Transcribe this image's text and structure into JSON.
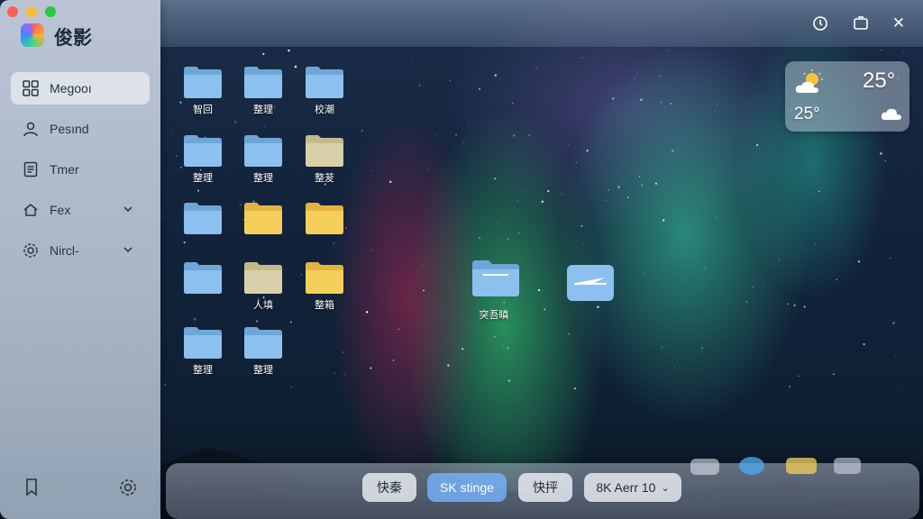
{
  "app": {
    "title": "俊影"
  },
  "sidebar": {
    "items": [
      {
        "label": "Megooı",
        "icon": "grid-icon",
        "active": true,
        "chevron": ""
      },
      {
        "label": "Pesınd",
        "icon": "person-icon",
        "active": false,
        "chevron": ""
      },
      {
        "label": "Tmer",
        "icon": "document-icon",
        "active": false,
        "chevron": ""
      },
      {
        "label": "Fex",
        "icon": "home-icon",
        "active": false,
        "chevron": "⌄"
      },
      {
        "label": "Nircl-",
        "icon": "gear-icon",
        "active": false,
        "chevron": "⌄"
      }
    ],
    "bottom": {
      "left_icon": "bookmark-icon",
      "right_icon": "settings-icon"
    }
  },
  "window_controls": {
    "icons": [
      "timer-icon",
      "restore-icon",
      "close-icon"
    ],
    "close_glyph": "✕"
  },
  "desktop": {
    "folders": [
      {
        "label": "智回",
        "color": "blue"
      },
      {
        "label": "整理",
        "color": "blue"
      },
      {
        "label": "校潮",
        "color": "blue"
      },
      {
        "label": "整理",
        "color": "blue"
      },
      {
        "label": "整理",
        "color": "blue"
      },
      {
        "label": "整茇",
        "color": "beige"
      },
      {
        "label": "",
        "color": "blue"
      },
      {
        "label": "",
        "color": "yellow"
      },
      {
        "label": "",
        "color": "yellow"
      },
      {
        "label": "",
        "color": "blue"
      },
      {
        "label": "人填",
        "color": "beige"
      },
      {
        "label": "整箱",
        "color": "yellow"
      },
      {
        "label": "整理",
        "color": "blue"
      },
      {
        "label": "整理",
        "color": "blue"
      },
      {
        "label": "",
        "color": "none"
      }
    ],
    "center_folder": {
      "label": "突吾瞋",
      "color": "blue"
    },
    "center_item": {
      "icon": "send-icon"
    }
  },
  "weather": {
    "temp_main": "25°",
    "temp_secondary": "25°",
    "icon_main": "sun-cloud-icon",
    "icon_secondary": "cloud-icon"
  },
  "dock": {
    "buttons": [
      {
        "label": "快秦",
        "primary": false
      },
      {
        "label": "SK stinge",
        "primary": true
      },
      {
        "label": "快抨",
        "primary": false
      },
      {
        "label": "8K Aerr 10",
        "primary": false,
        "chevron": "⌄"
      }
    ]
  },
  "colors": {
    "accent": "#6fb1ff",
    "folder_blue": "#7fb6ea",
    "folder_yellow": "#f4cf5c",
    "folder_beige": "#d9cfa9"
  }
}
